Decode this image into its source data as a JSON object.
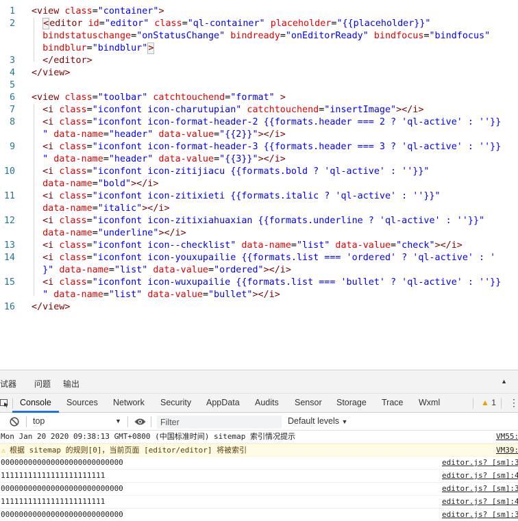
{
  "code": {
    "rows": [
      {
        "n": "1",
        "tokens": [
          [
            "t-tag",
            "<view "
          ],
          [
            "t-attr",
            "class"
          ],
          [
            "t-plain",
            "="
          ],
          [
            "t-str",
            "\"container\""
          ],
          [
            "t-tag",
            ">"
          ]
        ]
      },
      {
        "n": "2",
        "tokens": [
          [
            "t-plain",
            "  "
          ],
          [
            "cur",
            "<"
          ],
          [
            "t-tag",
            "editor "
          ],
          [
            "t-attr",
            "id"
          ],
          [
            "t-plain",
            "="
          ],
          [
            "t-str",
            "\"editor\""
          ],
          [
            "t-plain",
            " "
          ],
          [
            "t-attr",
            "class"
          ],
          [
            "t-plain",
            "="
          ],
          [
            "t-str",
            "\"ql-container\""
          ],
          [
            "t-plain",
            " "
          ],
          [
            "t-attr",
            "placeholder"
          ],
          [
            "t-plain",
            "="
          ],
          [
            "t-str",
            "\"{{placeholder}}\""
          ]
        ]
      },
      {
        "n": "",
        "tokens": [
          [
            "t-plain",
            "  "
          ],
          [
            "t-attr",
            "bindstatuschange"
          ],
          [
            "t-plain",
            "="
          ],
          [
            "t-str",
            "\"onStatusChange\""
          ],
          [
            "t-plain",
            " "
          ],
          [
            "t-attr",
            "bindready"
          ],
          [
            "t-plain",
            "="
          ],
          [
            "t-str",
            "\"onEditorReady\""
          ],
          [
            "t-plain",
            " "
          ],
          [
            "t-attr",
            "bindfocus"
          ],
          [
            "t-plain",
            "="
          ],
          [
            "t-str",
            "\"bindfocus\""
          ]
        ]
      },
      {
        "n": "",
        "tokens": [
          [
            "t-plain",
            "  "
          ],
          [
            "t-attr",
            "bindblur"
          ],
          [
            "t-plain",
            "="
          ],
          [
            "t-str",
            "\"bindblur\""
          ],
          [
            "cur",
            ">"
          ]
        ]
      },
      {
        "n": "3",
        "tokens": [
          [
            "t-plain",
            "  "
          ],
          [
            "t-tag",
            "</editor>"
          ]
        ]
      },
      {
        "n": "4",
        "tokens": [
          [
            "t-tag",
            "</view>"
          ]
        ]
      },
      {
        "n": "5",
        "tokens": []
      },
      {
        "n": "6",
        "tokens": [
          [
            "t-tag",
            "<view "
          ],
          [
            "t-attr",
            "class"
          ],
          [
            "t-plain",
            "="
          ],
          [
            "t-str",
            "\"toolbar\""
          ],
          [
            "t-plain",
            " "
          ],
          [
            "t-attr",
            "catchtouchend"
          ],
          [
            "t-plain",
            "="
          ],
          [
            "t-str",
            "\"format\""
          ],
          [
            "t-plain",
            " "
          ],
          [
            "t-tag",
            ">"
          ]
        ]
      },
      {
        "n": "7",
        "tokens": [
          [
            "t-plain",
            "  "
          ],
          [
            "t-tag",
            "<i "
          ],
          [
            "t-attr",
            "class"
          ],
          [
            "t-plain",
            "="
          ],
          [
            "t-str",
            "\"iconfont icon-charutupian\""
          ],
          [
            "t-plain",
            " "
          ],
          [
            "t-attr",
            "catchtouchend"
          ],
          [
            "t-plain",
            "="
          ],
          [
            "t-str",
            "\"insertImage\""
          ],
          [
            "t-tag",
            "></i>"
          ]
        ]
      },
      {
        "n": "8",
        "tokens": [
          [
            "t-plain",
            "  "
          ],
          [
            "t-tag",
            "<i "
          ],
          [
            "t-attr",
            "class"
          ],
          [
            "t-plain",
            "="
          ],
          [
            "t-str",
            "\"iconfont icon-format-header-2 {{formats.header === 2 ? 'ql-active' : ''}}"
          ]
        ]
      },
      {
        "n": "",
        "tokens": [
          [
            "t-plain",
            "  "
          ],
          [
            "t-str",
            "\""
          ],
          [
            "t-plain",
            " "
          ],
          [
            "t-attr",
            "data-name"
          ],
          [
            "t-plain",
            "="
          ],
          [
            "t-str",
            "\"header\""
          ],
          [
            "t-plain",
            " "
          ],
          [
            "t-attr",
            "data-value"
          ],
          [
            "t-plain",
            "="
          ],
          [
            "t-str",
            "\"{{2}}\""
          ],
          [
            "t-tag",
            "></i>"
          ]
        ]
      },
      {
        "n": "9",
        "tokens": [
          [
            "t-plain",
            "  "
          ],
          [
            "t-tag",
            "<i "
          ],
          [
            "t-attr",
            "class"
          ],
          [
            "t-plain",
            "="
          ],
          [
            "t-str",
            "\"iconfont icon-format-header-3 {{formats.header === 3 ? 'ql-active' : ''}}"
          ]
        ]
      },
      {
        "n": "",
        "tokens": [
          [
            "t-plain",
            "  "
          ],
          [
            "t-str",
            "\""
          ],
          [
            "t-plain",
            " "
          ],
          [
            "t-attr",
            "data-name"
          ],
          [
            "t-plain",
            "="
          ],
          [
            "t-str",
            "\"header\""
          ],
          [
            "t-plain",
            " "
          ],
          [
            "t-attr",
            "data-value"
          ],
          [
            "t-plain",
            "="
          ],
          [
            "t-str",
            "\"{{3}}\""
          ],
          [
            "t-tag",
            "></i>"
          ]
        ]
      },
      {
        "n": "10",
        "tokens": [
          [
            "t-plain",
            "  "
          ],
          [
            "t-tag",
            "<i "
          ],
          [
            "t-attr",
            "class"
          ],
          [
            "t-plain",
            "="
          ],
          [
            "t-str",
            "\"iconfont icon-zitijiacu {{formats.bold ? 'ql-active' : ''}}\""
          ]
        ]
      },
      {
        "n": "",
        "tokens": [
          [
            "t-plain",
            "  "
          ],
          [
            "t-attr",
            "data-name"
          ],
          [
            "t-plain",
            "="
          ],
          [
            "t-str",
            "\"bold\""
          ],
          [
            "t-tag",
            "></i>"
          ]
        ]
      },
      {
        "n": "11",
        "tokens": [
          [
            "t-plain",
            "  "
          ],
          [
            "t-tag",
            "<i "
          ],
          [
            "t-attr",
            "class"
          ],
          [
            "t-plain",
            "="
          ],
          [
            "t-str",
            "\"iconfont icon-zitixieti {{formats.italic ? 'ql-active' : ''}}\""
          ]
        ]
      },
      {
        "n": "",
        "tokens": [
          [
            "t-plain",
            "  "
          ],
          [
            "t-attr",
            "data-name"
          ],
          [
            "t-plain",
            "="
          ],
          [
            "t-str",
            "\"italic\""
          ],
          [
            "t-tag",
            "></i>"
          ]
        ]
      },
      {
        "n": "12",
        "tokens": [
          [
            "t-plain",
            "  "
          ],
          [
            "t-tag",
            "<i "
          ],
          [
            "t-attr",
            "class"
          ],
          [
            "t-plain",
            "="
          ],
          [
            "t-str",
            "\"iconfont icon-zitixiahuaxian {{formats.underline ? 'ql-active' : ''}}\""
          ]
        ]
      },
      {
        "n": "",
        "tokens": [
          [
            "t-plain",
            "  "
          ],
          [
            "t-attr",
            "data-name"
          ],
          [
            "t-plain",
            "="
          ],
          [
            "t-str",
            "\"underline\""
          ],
          [
            "t-tag",
            "></i>"
          ]
        ]
      },
      {
        "n": "13",
        "tokens": [
          [
            "t-plain",
            "  "
          ],
          [
            "t-tag",
            "<i "
          ],
          [
            "t-attr",
            "class"
          ],
          [
            "t-plain",
            "="
          ],
          [
            "t-str",
            "\"iconfont icon--checklist\""
          ],
          [
            "t-plain",
            " "
          ],
          [
            "t-attr",
            "data-name"
          ],
          [
            "t-plain",
            "="
          ],
          [
            "t-str",
            "\"list\""
          ],
          [
            "t-plain",
            " "
          ],
          [
            "t-attr",
            "data-value"
          ],
          [
            "t-plain",
            "="
          ],
          [
            "t-str",
            "\"check\""
          ],
          [
            "t-tag",
            "></i>"
          ]
        ]
      },
      {
        "n": "14",
        "tokens": [
          [
            "t-plain",
            "  "
          ],
          [
            "t-tag",
            "<i "
          ],
          [
            "t-attr",
            "class"
          ],
          [
            "t-plain",
            "="
          ],
          [
            "t-str",
            "\"iconfont icon-youxupailie {{formats.list === 'ordered' ? 'ql-active' : '"
          ]
        ]
      },
      {
        "n": "",
        "tokens": [
          [
            "t-plain",
            "  "
          ],
          [
            "t-str",
            "}\""
          ],
          [
            "t-plain",
            " "
          ],
          [
            "t-attr",
            "data-name"
          ],
          [
            "t-plain",
            "="
          ],
          [
            "t-str",
            "\"list\""
          ],
          [
            "t-plain",
            " "
          ],
          [
            "t-attr",
            "data-value"
          ],
          [
            "t-plain",
            "="
          ],
          [
            "t-str",
            "\"ordered\""
          ],
          [
            "t-tag",
            "></i>"
          ]
        ]
      },
      {
        "n": "15",
        "tokens": [
          [
            "t-plain",
            "  "
          ],
          [
            "t-tag",
            "<i "
          ],
          [
            "t-attr",
            "class"
          ],
          [
            "t-plain",
            "="
          ],
          [
            "t-str",
            "\"iconfont icon-wuxupailie {{formats.list === 'bullet' ? 'ql-active' : ''}}"
          ]
        ]
      },
      {
        "n": "",
        "tokens": [
          [
            "t-plain",
            "  "
          ],
          [
            "t-str",
            "\""
          ],
          [
            "t-plain",
            " "
          ],
          [
            "t-attr",
            "data-name"
          ],
          [
            "t-plain",
            "="
          ],
          [
            "t-str",
            "\"list\""
          ],
          [
            "t-plain",
            " "
          ],
          [
            "t-attr",
            "data-value"
          ],
          [
            "t-plain",
            "="
          ],
          [
            "t-str",
            "\"bullet\""
          ],
          [
            "t-tag",
            "></i>"
          ]
        ]
      },
      {
        "n": "16",
        "tokens": [
          [
            "t-tag",
            "</view>"
          ]
        ]
      }
    ]
  },
  "drawer": {
    "tabs": [
      "调试器",
      "问题",
      "输出"
    ],
    "collapse_icon": "triangle-up-icon"
  },
  "devtools": {
    "tabs": [
      "Console",
      "Sources",
      "Network",
      "Security",
      "AppData",
      "Audits",
      "Sensor",
      "Storage",
      "Trace",
      "Wxml"
    ],
    "active_tab": "Console",
    "warning_count": "1",
    "accent": "#1a73e8",
    "warning_color": "#e8a000"
  },
  "filter": {
    "context": "top",
    "placeholder": "Filter",
    "levels": "Default levels"
  },
  "console": {
    "rows": [
      {
        "type": "info",
        "msg": "Mon Jan 20 2020 09:38:13 GMT+0800 (中国标准时间) sitemap 索引情况提示",
        "src": "VM55:"
      },
      {
        "type": "warn",
        "msg": "根据 sitemap 的规则[0]，当前页面 [editor/editor] 将被索引",
        "src": "VM39:"
      },
      {
        "type": "log",
        "msg": "000000000000000000000000000",
        "src": "editor.js? [sm]:3"
      },
      {
        "type": "log",
        "msg": "11111111111111111111111",
        "src": "editor.js? [sm]:4"
      },
      {
        "type": "log",
        "msg": "000000000000000000000000000",
        "src": "editor.js? [sm]:3"
      },
      {
        "type": "log",
        "msg": "11111111111111111111111",
        "src": "editor.js? [sm]:4"
      },
      {
        "type": "log",
        "msg": "000000000000000000000000000",
        "src": "editor.js? [sm]:3"
      }
    ]
  }
}
